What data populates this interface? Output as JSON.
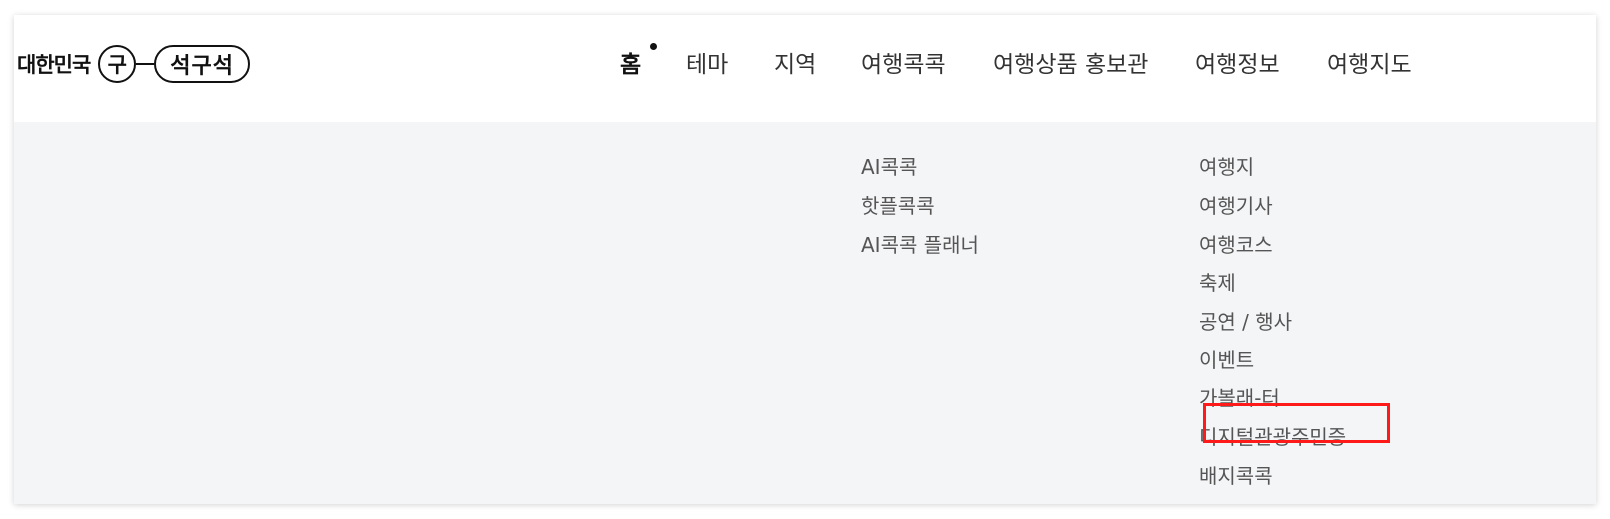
{
  "logo": {
    "left_text": "대한민국",
    "circle_char": "구",
    "pill_text": "석구석"
  },
  "nav": {
    "items": [
      {
        "label": "홈"
      },
      {
        "label": "테마"
      },
      {
        "label": "지역"
      },
      {
        "label": "여행콕콕"
      },
      {
        "label": "여행상품 홍보관"
      },
      {
        "label": "여행정보"
      },
      {
        "label": "여행지도"
      }
    ],
    "active_index": 0
  },
  "submenus": {
    "travel_kokkok": [
      "AI콕콕",
      "핫플콕콕",
      "AI콕콕 플래너"
    ],
    "travel_info": [
      "여행지",
      "여행기사",
      "여행코스",
      "축제",
      "공연 / 행사",
      "이벤트",
      "가볼래-터",
      "디지털관광주민증",
      "배지콕콕"
    ]
  },
  "highlight": {
    "label": "디지털관광주민증",
    "color": "#ff1a1a"
  },
  "colors": {
    "submenu_bg": "#f4f5f7",
    "text": "#333333"
  }
}
